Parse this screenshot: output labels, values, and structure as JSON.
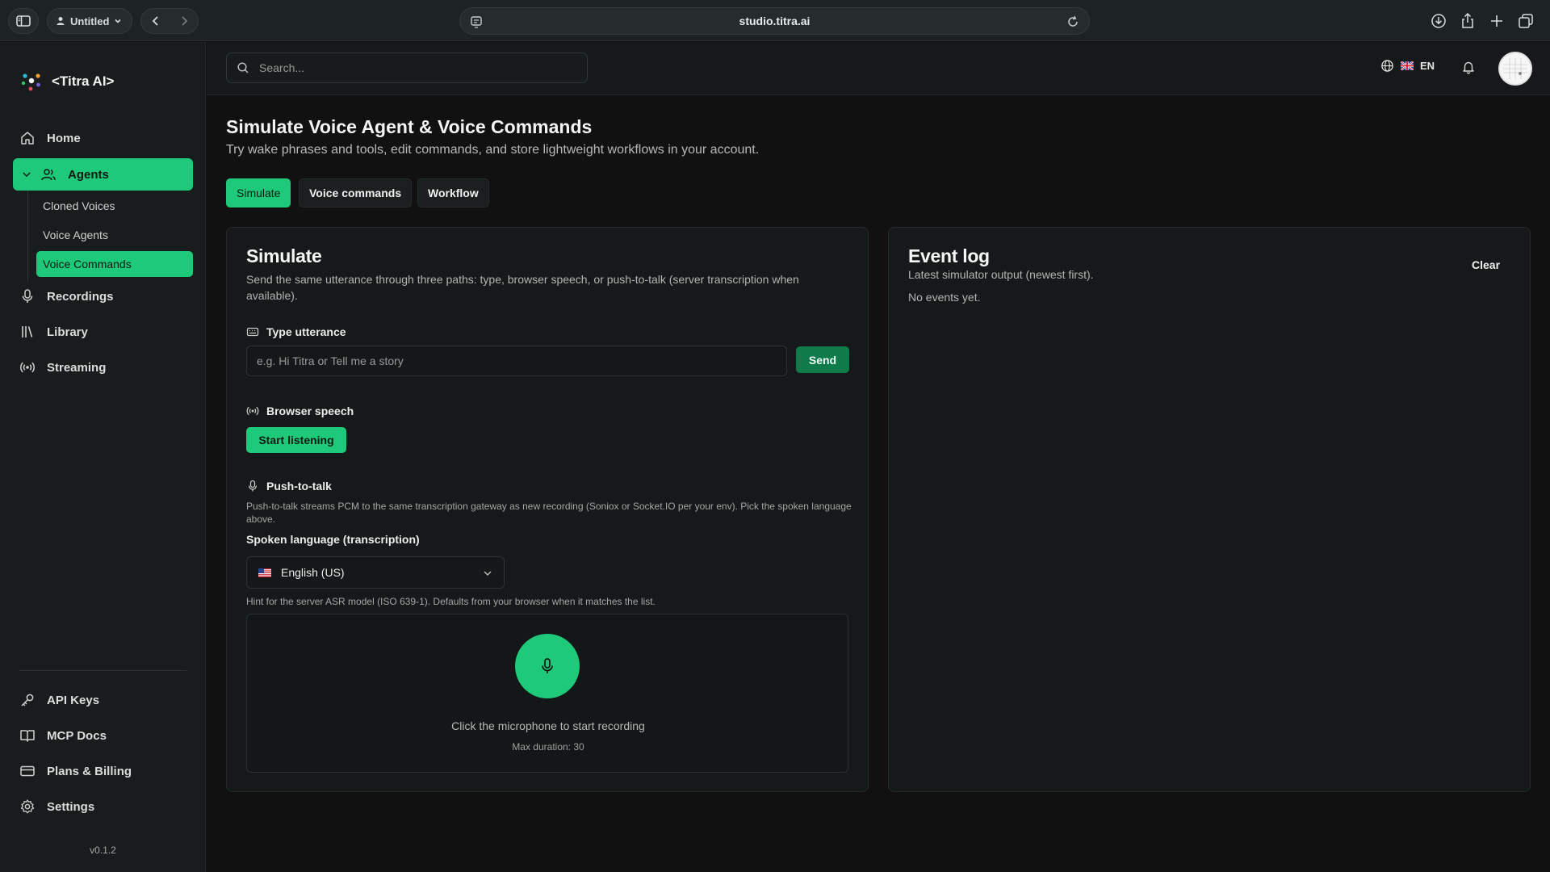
{
  "browser": {
    "profile_label": "Untitled",
    "url": "studio.titra.ai"
  },
  "sidebar": {
    "brand": "<Titra AI>",
    "items": [
      {
        "label": "Home",
        "icon": "home-icon"
      },
      {
        "label": "Agents",
        "icon": "users-icon",
        "expanded": true,
        "active": true
      },
      {
        "label": "Recordings",
        "icon": "mic-icon"
      },
      {
        "label": "Library",
        "icon": "library-icon"
      },
      {
        "label": "Streaming",
        "icon": "broadcast-icon"
      }
    ],
    "sub_items": [
      {
        "label": "Cloned Voices"
      },
      {
        "label": "Voice Agents"
      },
      {
        "label": "Voice Commands",
        "active": true
      }
    ],
    "bottom_items": [
      {
        "label": "API Keys",
        "icon": "key-icon"
      },
      {
        "label": "MCP Docs",
        "icon": "book-icon"
      },
      {
        "label": "Plans & Billing",
        "icon": "card-icon"
      },
      {
        "label": "Settings",
        "icon": "gear-icon"
      }
    ],
    "version": "v0.1.2"
  },
  "topbar": {
    "search_placeholder": "Search...",
    "language": "EN"
  },
  "page": {
    "title": "Simulate Voice Agent & Voice Commands",
    "subtitle": "Try wake phrases and tools, edit commands, and store lightweight workflows in your account.",
    "tabs": [
      {
        "label": "Simulate",
        "active": true
      },
      {
        "label": "Voice commands"
      },
      {
        "label": "Workflow"
      }
    ]
  },
  "simulate": {
    "title": "Simulate",
    "description": "Send the same utterance through three paths: type, browser speech, or push-to-talk (server transcription when available).",
    "type_label": "Type utterance",
    "utterance_placeholder": "e.g. Hi Titra or Tell me a story",
    "utterance_value": "",
    "send_label": "Send",
    "browser_speech_label": "Browser speech",
    "start_listening_label": "Start listening",
    "ptt_label": "Push-to-talk",
    "ptt_description": "Push-to-talk streams PCM to the same transcription gateway as new recording (Soniox or Socket.IO per your env). Pick the spoken language above.",
    "spoken_language_label": "Spoken language (transcription)",
    "spoken_language_value": "English (US)",
    "spoken_language_hint": "Hint for the server ASR model (ISO 639-1). Defaults from your browser when it matches the list.",
    "mic_caption": "Click the microphone to start recording",
    "max_duration": "Max duration: 30"
  },
  "event_log": {
    "title": "Event log",
    "subtitle": "Latest simulator output (newest first).",
    "clear_label": "Clear",
    "empty_text": "No events yet."
  },
  "colors": {
    "accent": "#1ec97a",
    "send_button": "#0f7a4a",
    "background": "#111111"
  }
}
